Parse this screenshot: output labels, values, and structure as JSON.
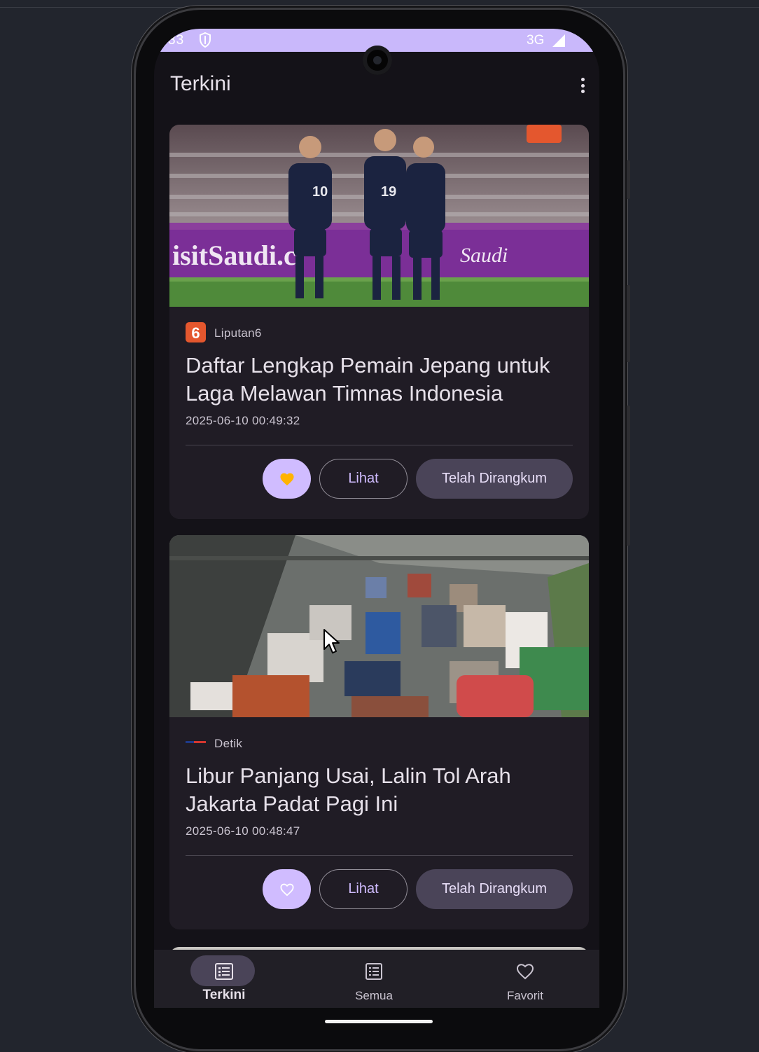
{
  "status_bar": {
    "time_fragment": "33",
    "network": "3G",
    "background": "#c9b8fb"
  },
  "app_bar": {
    "title": "Terkini"
  },
  "articles": [
    {
      "source": "Liputan6",
      "title": "Daftar Lengkap Pemain Jepang untuk Laga Melawan Timnas Indonesia",
      "date": "2025-06-10 00:49:32",
      "favorited": true,
      "view_label": "Lihat",
      "summary_label": "Telah Dirangkum",
      "image_alt": "soccer-players-photo"
    },
    {
      "source": "Detik",
      "title": "Libur Panjang Usai, Lalin Tol Arah Jakarta Padat Pagi Ini",
      "date": "2025-06-10 00:48:47",
      "favorited": false,
      "view_label": "Lihat",
      "summary_label": "Telah Dirangkum",
      "image_alt": "traffic-jam-photo"
    }
  ],
  "bottom_nav": [
    {
      "label": "Terkini",
      "icon": "news-list-icon",
      "active": true
    },
    {
      "label": "Semua",
      "icon": "list-icon",
      "active": false
    },
    {
      "label": "Favorit",
      "icon": "heart-icon",
      "active": false
    }
  ],
  "colors": {
    "primary": "#d0bcff",
    "surface": "#141218",
    "card": "#201c25",
    "tonal": "#4a4458",
    "favorite_heart": "#ffb300"
  }
}
